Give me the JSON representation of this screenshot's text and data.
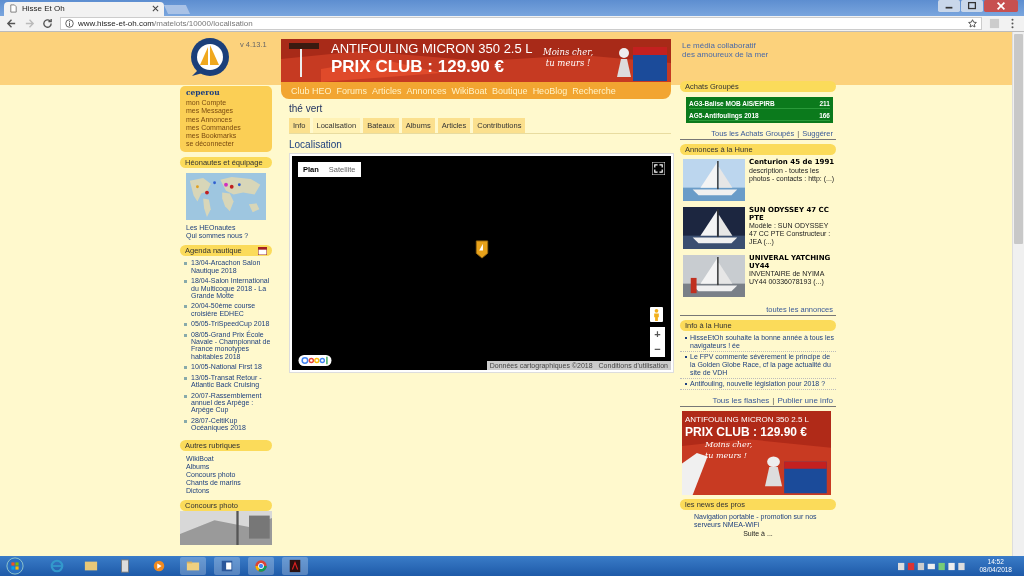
{
  "browser": {
    "tab_title": "Hisse Et Oh",
    "url_host": "www.hisse-et-oh.com",
    "url_path": "/matelots/10000/localisation"
  },
  "header": {
    "version": "v 4.13.1",
    "tagline": [
      "Le média collaboratif",
      "des amoureux de la mer"
    ]
  },
  "banner": {
    "headline": "ANTIFOULING MICRON 350 2.5 L",
    "price": "PRIX CLUB : 129.90 €",
    "slogan": [
      "Moins cher,",
      "tu meurs !"
    ]
  },
  "nav": [
    "Club HEO",
    "Forums",
    "Articles",
    "Annonces",
    "WikiBoat",
    "Boutique",
    "HeoBlog",
    "Recherche"
  ],
  "user": {
    "name": "ceperou",
    "links": [
      "mon Compte",
      "mes Messages",
      "mes Annonces",
      "mes Commandes",
      "mes Bookmarks",
      "se déconnecter"
    ]
  },
  "heonautes": {
    "title": "Héonautes et équipage",
    "links": [
      "Les HEOnautes",
      "Qui sommes nous ?"
    ]
  },
  "agenda": {
    "title": "Agenda nautique",
    "events": [
      "13/04-Arcachon Salon Nautique 2018",
      "18/04-Salon International du Multicoque 2018 - La Grande Motte",
      "20/04-50ème course croisière EDHEC",
      "05/05-TriSpeedCup 2018",
      "08/05-Grand Prix École Navale - Championnat de France monotypes habitables 2018",
      "10/05-National First 18",
      "13/05-Transat Retour - Atlantic Back Cruising",
      "20/07-Rassemblement annuel des Arpège : Arpège Cup",
      "28/07-CeltiKup Océaniques 2018"
    ]
  },
  "autres": {
    "title": "Autres rubriques",
    "links": [
      "WikiBoat",
      "Albums",
      "Concours photo",
      "Chants de marins",
      "Dictons"
    ]
  },
  "concours": {
    "title": "Concours photo"
  },
  "page": {
    "title": "thé vert",
    "tabs": [
      {
        "label": "Info",
        "selected": false
      },
      {
        "label": "Localisation",
        "selected": true
      },
      {
        "label": "Bateaux",
        "selected": false
      },
      {
        "label": "Albums",
        "selected": false
      },
      {
        "label": "Articles",
        "selected": false
      },
      {
        "label": "Contributions",
        "selected": false
      }
    ],
    "section_title": "Localisation",
    "map": {
      "map_types": [
        {
          "label": "Plan",
          "selected": true
        },
        {
          "label": "Satellite",
          "selected": false
        }
      ],
      "attribution": "Données cartographiques ©2018",
      "terms": "Conditions d'utilisation",
      "zoom_in": "+",
      "zoom_out": "−"
    }
  },
  "achats": {
    "title": "Achats Groupés",
    "rows": [
      {
        "name": "AG3-Balise MOB AIS/EPIRB",
        "count": "211"
      },
      {
        "name": "AG5-Antifoulings 2018",
        "count": "166"
      }
    ],
    "links": [
      "Tous les Achats Groupés",
      "Suggérer"
    ],
    "separator": "|"
  },
  "annonces": {
    "title": "Annonces à la Hune",
    "items": [
      {
        "title": "Centurion 45 de 1991",
        "text": "description - toutes les photos - contacts : http: (...)"
      },
      {
        "title": "SUN ODYSSEY 47 CC PTE",
        "text": "Modèle : SUN ODYSSEY 47 CC PTE Constructeur : JEA (...)"
      },
      {
        "title": "UNIVERAL YATCHING UY44",
        "text": "INVENTAIRE de NYIMA UY44 00336078193 (...)"
      }
    ],
    "more": "toutes les annonces"
  },
  "info": {
    "title": "Info à la Hune",
    "items": [
      "HisseEtOh souhaite la bonne année à tous les navigateurs ! ée",
      "Le FPV commente sévèrement le principe de la Golden Globe Race, cf la page actualité du site de VDH",
      "Antifouling, nouvelle législation pour 2018 ?"
    ],
    "links": [
      "Tous les flashes",
      "Publier une info"
    ],
    "separator": "|"
  },
  "ad2": {
    "headline": "ANTIFOULING MICRON 350 2.5 L",
    "price": "PRIX CLUB : 129.90 €",
    "slogan": [
      "Moins cher,",
      "tu meurs !"
    ]
  },
  "news": {
    "title": "les news des pros",
    "text": "Navigation portable - promotion sur nos serveurs NMEA-WiFi",
    "more": "Suite à ..."
  },
  "taskbar": {
    "time": "14:52",
    "date": "08/04/2018"
  }
}
